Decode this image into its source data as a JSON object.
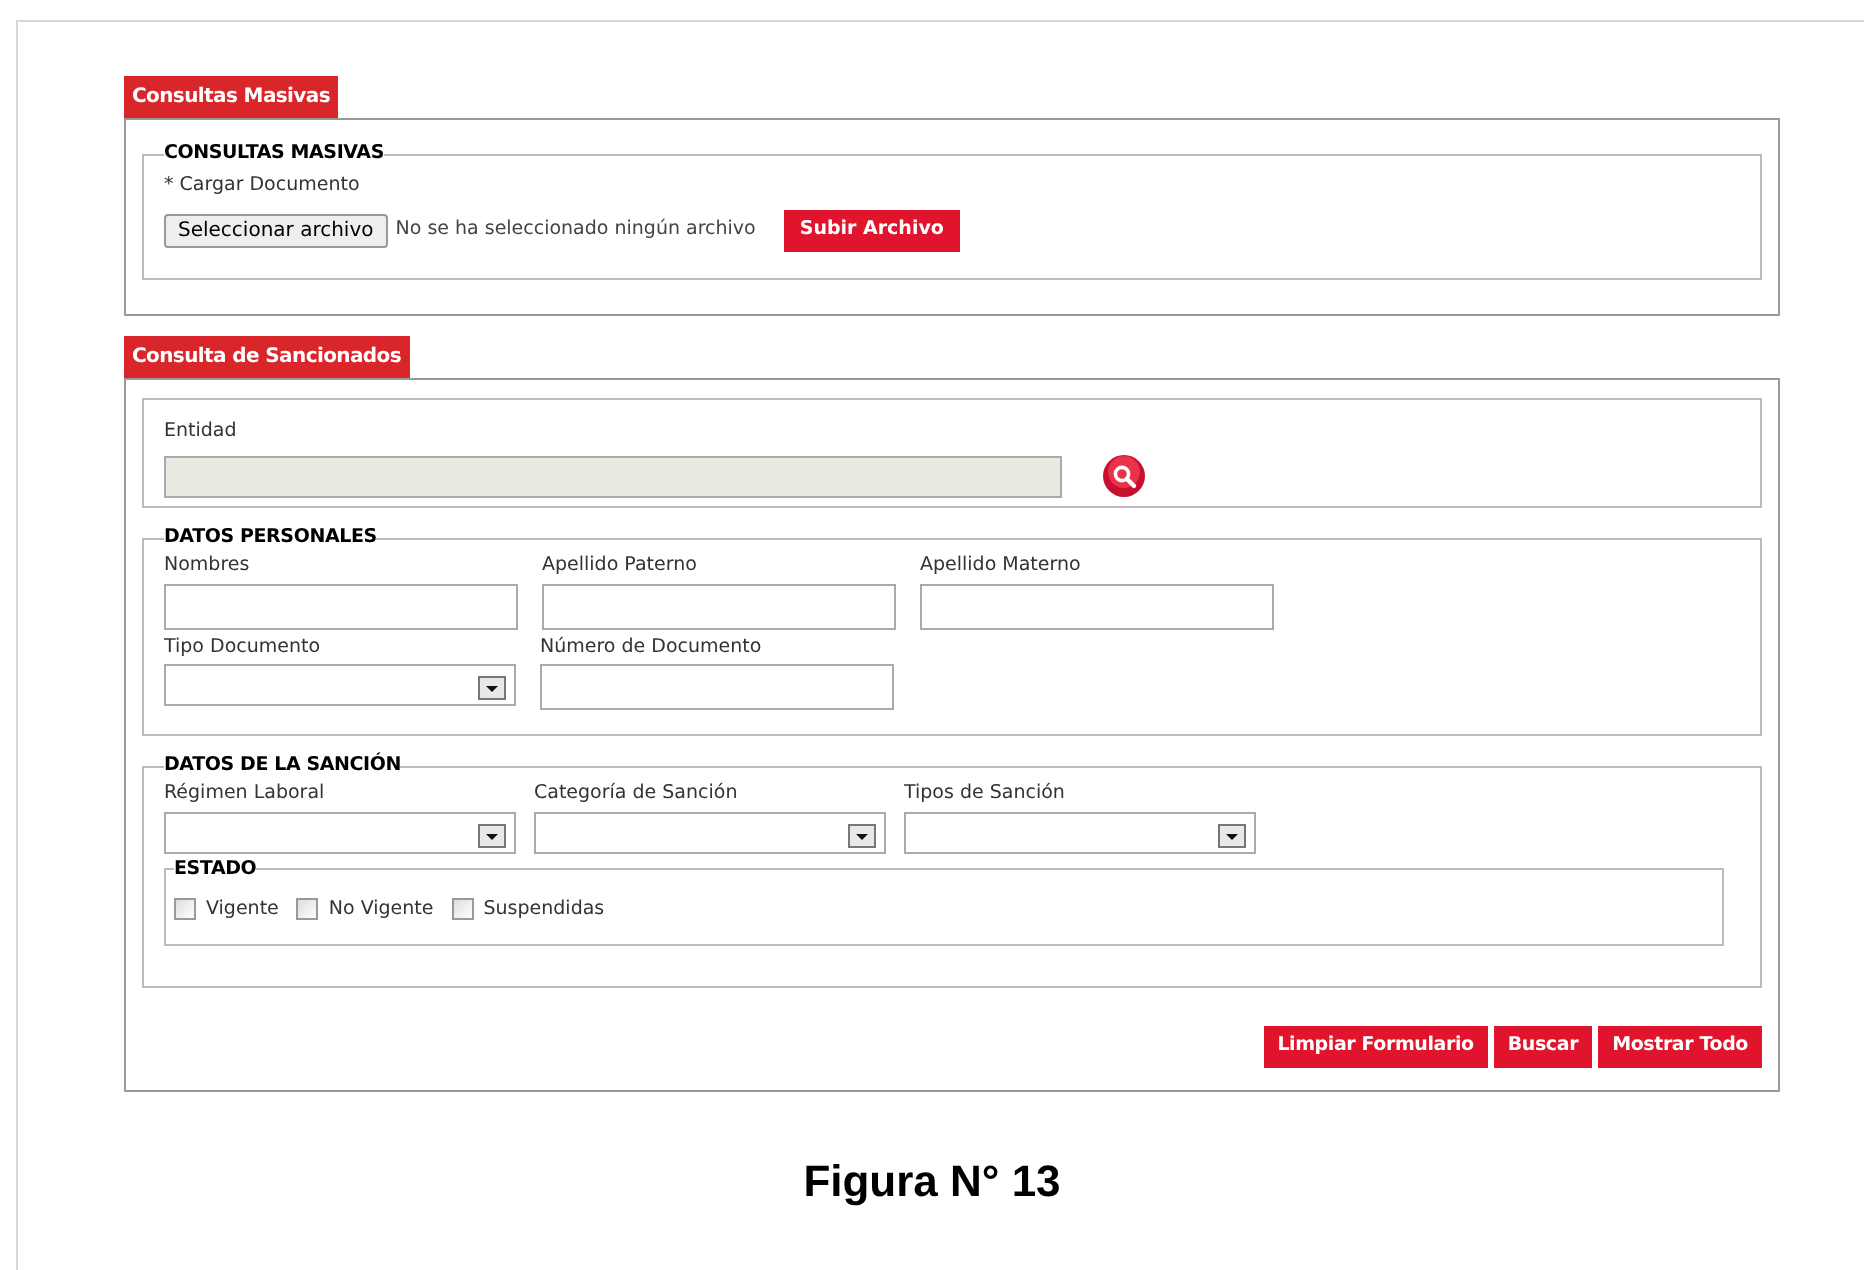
{
  "masivas": {
    "tab": "Consultas Masivas",
    "legend": "CONSULTAS MASIVAS",
    "label": "* Cargar Documento",
    "file_button": "Seleccionar archivo",
    "file_status": "No se ha seleccionado ningún archivo",
    "upload_button": "Subir Archivo"
  },
  "sancionados": {
    "tab": "Consulta de Sancionados",
    "entidad": {
      "label": "Entidad",
      "disabled": true
    },
    "personales": {
      "legend": "DATOS PERSONALES",
      "fields": [
        {
          "label": "Nombres",
          "kind": "text"
        },
        {
          "label": "Apellido Paterno",
          "kind": "text"
        },
        {
          "label": "Apellido Materno",
          "kind": "text"
        },
        {
          "label": "Tipo Documento",
          "kind": "select"
        },
        {
          "label": "Número de Documento",
          "kind": "text"
        }
      ]
    },
    "sancion": {
      "legend": "DATOS DE LA SANCIÓN",
      "fields": [
        {
          "label": "Régimen Laboral",
          "kind": "select"
        },
        {
          "label": "Categoría de Sanción",
          "kind": "select"
        },
        {
          "label": "Tipos de Sanción",
          "kind": "select"
        }
      ],
      "estado": {
        "legend": "ESTADO",
        "options": [
          {
            "label": "Vigente",
            "checked": false
          },
          {
            "label": "No Vigente",
            "checked": false
          },
          {
            "label": "Suspendidas",
            "checked": false
          }
        ]
      }
    },
    "buttons": [
      "Limpiar Formulario",
      "Buscar",
      "Mostrar Todo"
    ]
  },
  "caption": "Figura N° 13"
}
